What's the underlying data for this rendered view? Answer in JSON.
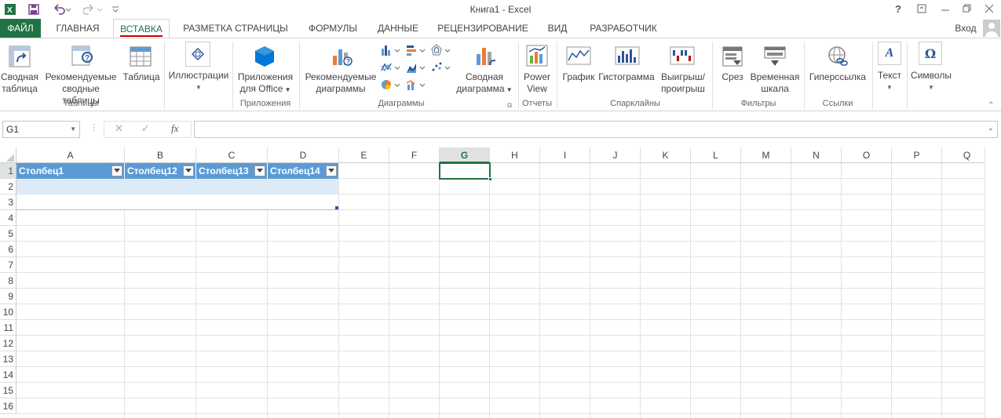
{
  "window": {
    "title": "Книга1 - Excel",
    "help": "?"
  },
  "tabs": [
    "ФАЙЛ",
    "ГЛАВНАЯ",
    "ВСТАВКА",
    "РАЗМЕТКА СТРАНИЦЫ",
    "ФОРМУЛЫ",
    "ДАННЫЕ",
    "РЕЦЕНЗИРОВАНИЕ",
    "ВИД",
    "РАЗРАБОТЧИК"
  ],
  "user": {
    "signin": "Вход"
  },
  "ribbon": {
    "pivot_table": [
      "Сводная",
      "таблица"
    ],
    "recommended_pivots": [
      "Рекомендуемые",
      "сводные таблицы"
    ],
    "table": "Таблица",
    "group_tables": "Таблицы",
    "illustrations": "Иллюстрации",
    "apps_for_office": [
      "Приложения",
      "для Office"
    ],
    "group_apps": "Приложения",
    "recommended_charts": [
      "Рекомендуемые",
      "диаграммы"
    ],
    "pivot_chart": [
      "Сводная",
      "диаграмма"
    ],
    "group_charts": "Диаграммы",
    "power_view": [
      "Power",
      "View"
    ],
    "group_reports": "Отчеты",
    "spark_line": "График",
    "spark_column": "Гистограмма",
    "spark_winloss": [
      "Выигрыш/",
      "проигрыш"
    ],
    "group_sparklines": "Спарклайны",
    "slicer": "Срез",
    "timeline": [
      "Временная",
      "шкала"
    ],
    "group_filters": "Фильтры",
    "hyperlink": "Гиперссылка",
    "group_links": "Ссылки",
    "text": "Текст",
    "symbols": "Символы"
  },
  "formula_bar": {
    "name_box": "G1",
    "fx": "fx",
    "value": ""
  },
  "columns": [
    "A",
    "B",
    "C",
    "D",
    "E",
    "F",
    "G",
    "H",
    "I",
    "J",
    "K",
    "L",
    "M",
    "N",
    "O",
    "P",
    "Q"
  ],
  "rows": [
    "1",
    "2",
    "3",
    "4",
    "5",
    "6",
    "7",
    "8",
    "9",
    "10",
    "11",
    "12",
    "13",
    "14",
    "15",
    "16"
  ],
  "table_headers": [
    "Столбец1",
    "Столбец12",
    "Столбец13",
    "Столбец14"
  ],
  "colors": {
    "accent": "#217346",
    "table_header": "#5b9bd5",
    "table_band": "#ddebf7"
  }
}
